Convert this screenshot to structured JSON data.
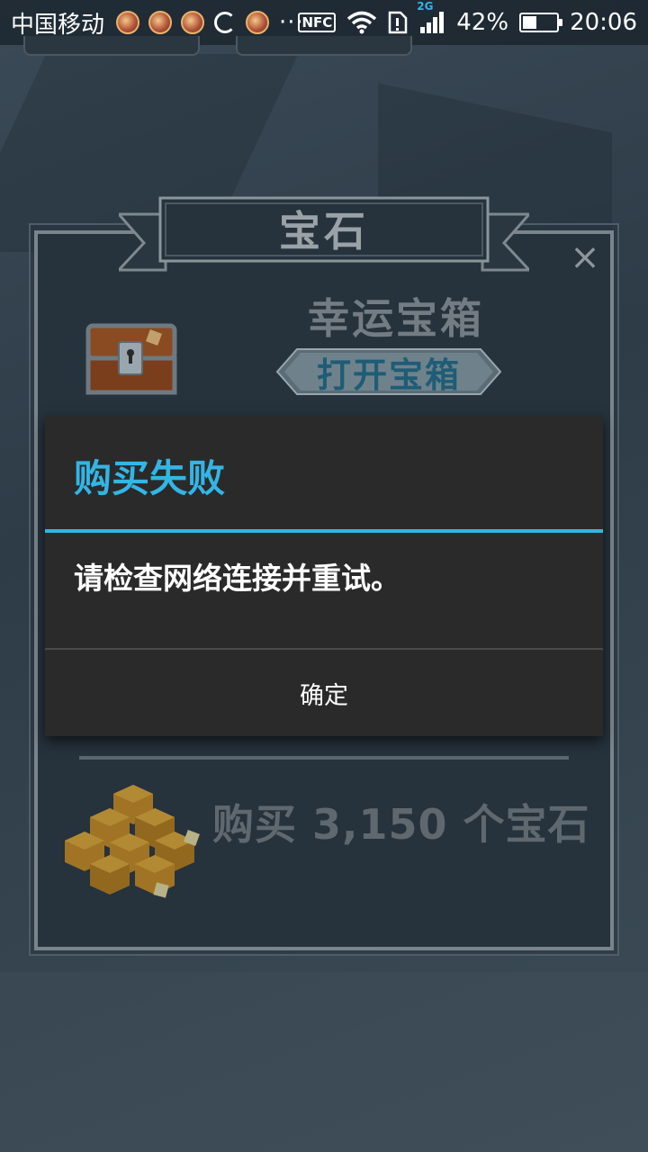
{
  "status_bar": {
    "carrier": "中国移动",
    "dots": "···",
    "nfc": "NFC",
    "network_type": "2G",
    "battery_text": "42%",
    "battery_level": 0.42,
    "time": "20:06"
  },
  "panel": {
    "title": "宝石",
    "close_glyph": "×",
    "lucky_chest_title": "幸运宝箱",
    "open_chest_label": "打开宝箱",
    "buy_gems_label": "购买 3,150 个宝石"
  },
  "dialog": {
    "title": "购买失败",
    "message": "请检查网络连接并重试。",
    "ok_label": "确定"
  },
  "colors": {
    "dialog_accent": "#33b5e5",
    "dialog_bg": "#2a2a2a",
    "open_btn_text": "#1f5c76"
  }
}
